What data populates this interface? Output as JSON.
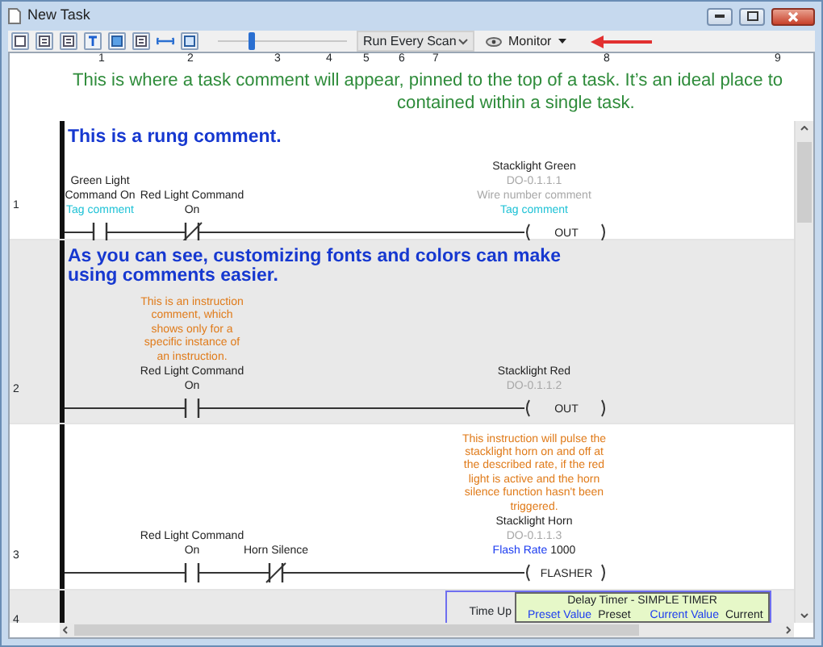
{
  "window": {
    "title": "New Task"
  },
  "toolbar": {
    "slider": {
      "level": 0.25
    },
    "scan_mode": "Run Every Scan",
    "monitor": "Monitor"
  },
  "column_numbers": [
    "1",
    "2",
    "3",
    "4",
    "5",
    "6",
    "7",
    "8",
    "9"
  ],
  "task_comment": [
    "This is where a task comment will appear, pinned to the top of a task.  It’s an ideal place to",
    "contained within a single task."
  ],
  "rungs": [
    {
      "number": "1",
      "comment": "This is a rung comment.",
      "instructions": [
        {
          "kind": "contact",
          "labels": [
            {
              "kind": "name",
              "text": "Green Light"
            },
            {
              "kind": "name",
              "text": "Command On"
            },
            {
              "kind": "tag",
              "text": "Tag comment"
            }
          ]
        },
        {
          "kind": "contact_nc",
          "labels": [
            {
              "kind": "name",
              "text": "Red Light Command"
            },
            {
              "kind": "name",
              "text": "On"
            }
          ]
        },
        {
          "kind": "coil",
          "name": "OUT",
          "labels": [
            {
              "kind": "name",
              "text": "Stacklight Green"
            },
            {
              "kind": "address",
              "text": "DO-0.1.1.1"
            },
            {
              "kind": "wire",
              "text": "Wire number comment"
            },
            {
              "kind": "tag",
              "text": "Tag comment"
            }
          ]
        }
      ]
    },
    {
      "number": "2",
      "comment": "As you can see, customizing fonts and colors can make using comments easier.",
      "instructions": [
        {
          "kind": "contact",
          "labels": [
            {
              "kind": "note",
              "text": "This is an instruction comment, which shows only for a specific instance of an instruction."
            },
            {
              "kind": "name",
              "text": "Red Light Command"
            },
            {
              "kind": "name",
              "text": "On"
            }
          ]
        },
        {
          "kind": "coil",
          "name": "OUT",
          "labels": [
            {
              "kind": "name",
              "text": "Stacklight Red"
            },
            {
              "kind": "address",
              "text": "DO-0.1.1.2"
            }
          ]
        }
      ]
    },
    {
      "number": "3",
      "instructions": [
        {
          "kind": "contact",
          "labels": [
            {
              "kind": "name",
              "text": "Red Light Command"
            },
            {
              "kind": "name",
              "text": "On"
            }
          ]
        },
        {
          "kind": "contact_nc",
          "labels": [
            {
              "kind": "name",
              "text": "Horn Silence"
            }
          ]
        },
        {
          "kind": "coil",
          "name": "FLASHER",
          "labels": [
            {
              "kind": "note",
              "text": "This instruction will pulse the stacklight horn on and off at the described rate, if the red light is active and the horn silence function hasn't been triggered."
            },
            {
              "kind": "name",
              "text": "Stacklight Horn"
            },
            {
              "kind": "address",
              "text": "DO-0.1.1.3"
            },
            {
              "kind": "param",
              "text": "Flash Rate",
              "value": "1000"
            }
          ]
        }
      ]
    },
    {
      "number": "4",
      "instructions": [
        {
          "kind": "box",
          "output": "Time Up",
          "title": "Delay Timer - SIMPLE TIMER",
          "fields": [
            {
              "label": "Preset Value",
              "value": "Preset"
            },
            {
              "label": "Current Value",
              "value": "Current"
            }
          ]
        }
      ]
    }
  ]
}
